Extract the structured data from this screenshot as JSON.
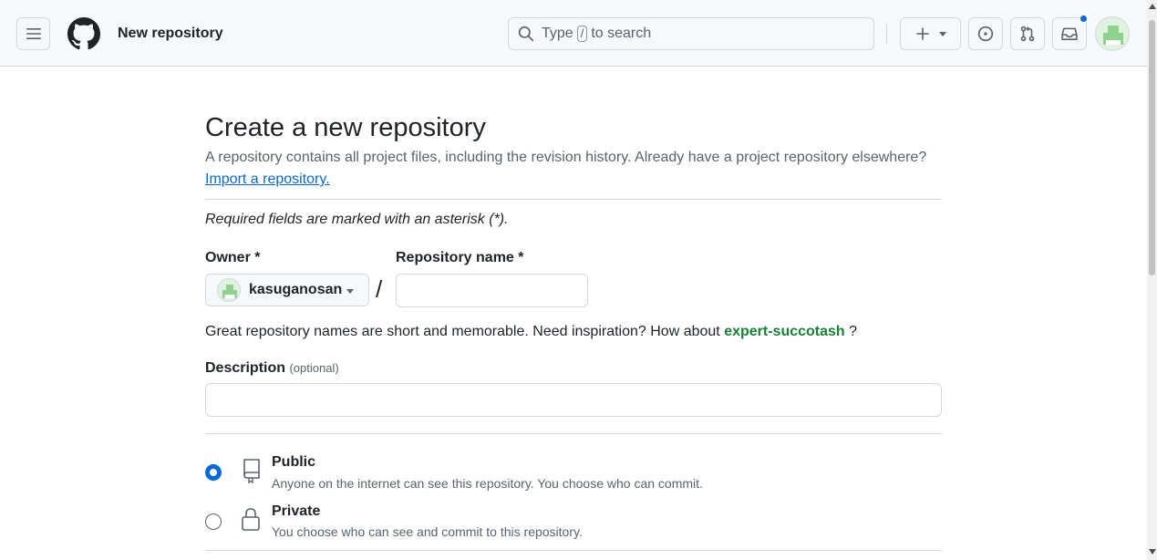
{
  "header": {
    "context_title": "New repository",
    "search_prefix": "Type",
    "search_key": "/",
    "search_suffix": "to search",
    "accent_color": "#0969da"
  },
  "page": {
    "title": "Create a new repository",
    "subtitle": "A repository contains all project files, including the revision history. Already have a project repository elsewhere?",
    "import_link": "Import a repository.",
    "required_note": "Required fields are marked with an asterisk (*)."
  },
  "form": {
    "owner_label": "Owner *",
    "owner_value": "kasuganosan",
    "separator": "/",
    "repo_name_label": "Repository name *",
    "repo_name_value": "",
    "hint_text": "Great repository names are short and memorable. Need inspiration? How about",
    "suggestion": "expert-succotash",
    "hint_end": "?",
    "description_label": "Description",
    "description_optional": "(optional)",
    "description_value": ""
  },
  "visibility": {
    "options": [
      {
        "title": "Public",
        "description": "Anyone on the internet can see this repository. You choose who can commit.",
        "selected": true,
        "icon": "repo-icon"
      },
      {
        "title": "Private",
        "description": "You choose who can see and commit to this repository.",
        "selected": false,
        "icon": "lock-icon"
      }
    ]
  }
}
